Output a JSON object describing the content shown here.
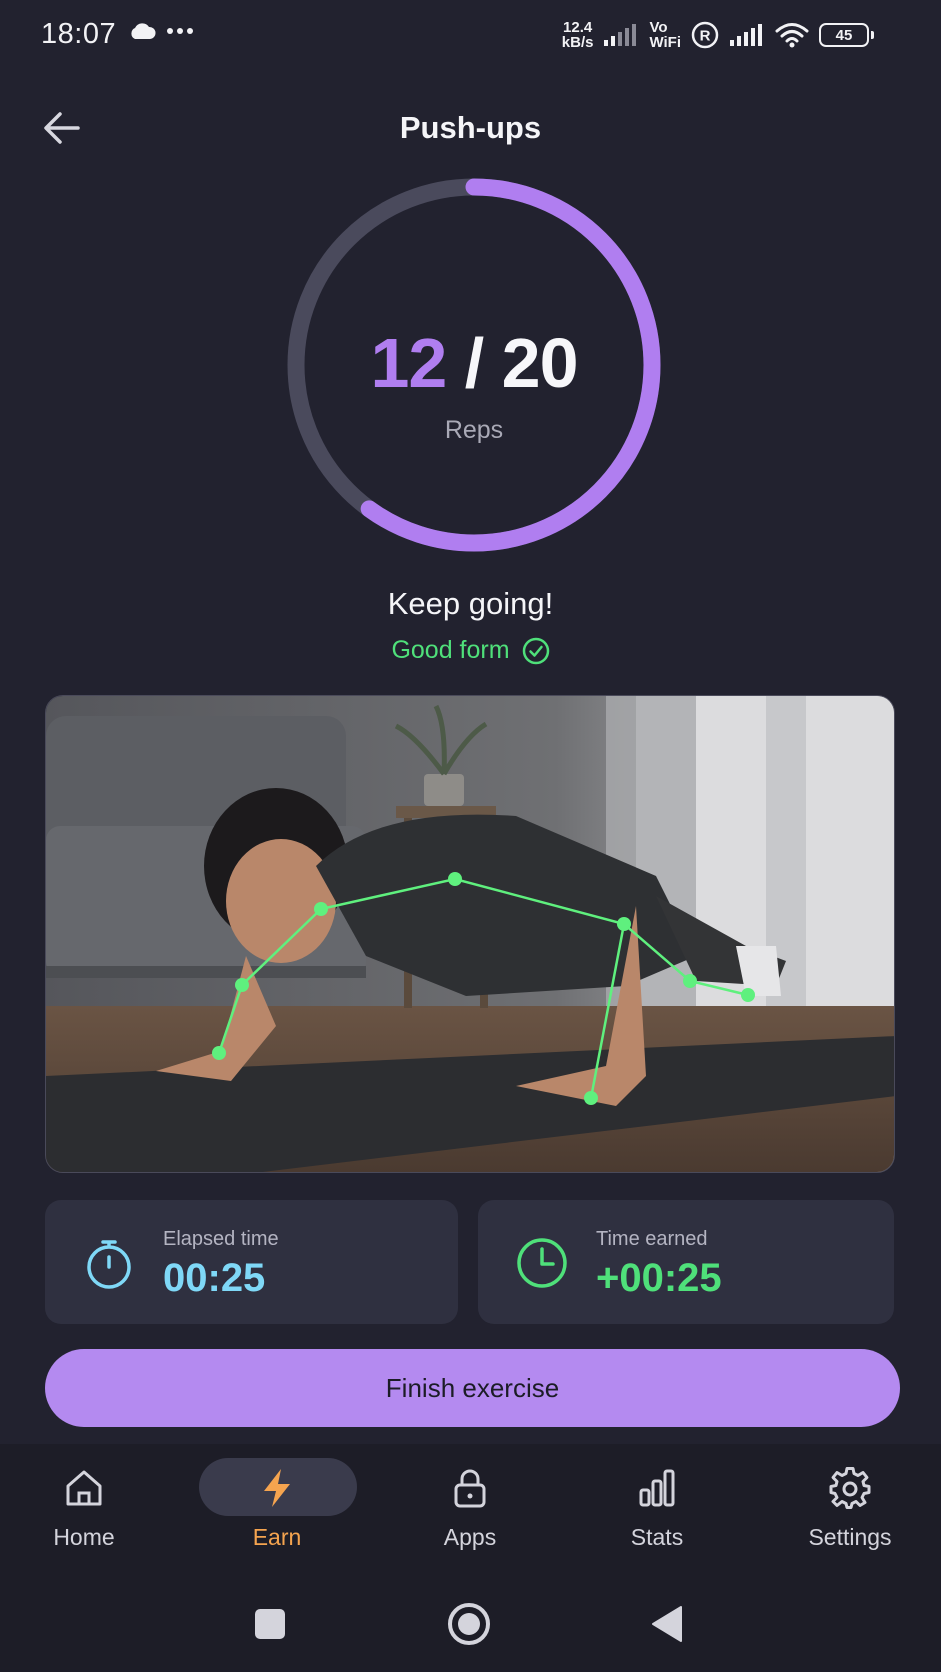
{
  "status_bar": {
    "time": "18:07",
    "left_icons": [
      "cloud-icon",
      "more-dots-icon"
    ],
    "net_speed_value": "12.4",
    "net_speed_unit": "kB/s",
    "vo": "Vo",
    "wifi_label": "WiFi",
    "roaming": "R",
    "battery": "45"
  },
  "header": {
    "back_icon": "arrow-left-icon",
    "title": "Push-ups"
  },
  "progress": {
    "current": "12",
    "separator": " / ",
    "total": "20",
    "fraction": 0.6,
    "label": "Reps",
    "accent_color": "#b07ef0",
    "track_color": "#4a4a5c"
  },
  "feedback": {
    "message": "Keep going!",
    "form_status": "Good form",
    "form_icon": "check-circle-icon",
    "form_color": "#4fe07a"
  },
  "camera": {
    "description_icon": "camera-feed",
    "skeleton_color": "#5ff07e"
  },
  "stats": {
    "elapsed": {
      "label": "Elapsed time",
      "value": "00:25",
      "icon": "stopwatch-icon",
      "color": "#7fd8f7"
    },
    "earned": {
      "label": "Time earned",
      "value": "+00:25",
      "icon": "clock-icon",
      "color": "#4fe07a"
    }
  },
  "actions": {
    "finish_label": "Finish exercise"
  },
  "bottom_nav": {
    "items": [
      {
        "label": "Home",
        "icon": "home-icon",
        "active": false
      },
      {
        "label": "Earn",
        "icon": "lightning-icon",
        "active": true
      },
      {
        "label": "Apps",
        "icon": "lock-icon",
        "active": false
      },
      {
        "label": "Stats",
        "icon": "bar-chart-icon",
        "active": false
      },
      {
        "label": "Settings",
        "icon": "gear-icon",
        "active": false
      }
    ],
    "active_color": "#f5a44f"
  },
  "system_nav": {
    "buttons": [
      "recents-square-icon",
      "home-circle-icon",
      "back-triangle-icon"
    ]
  }
}
